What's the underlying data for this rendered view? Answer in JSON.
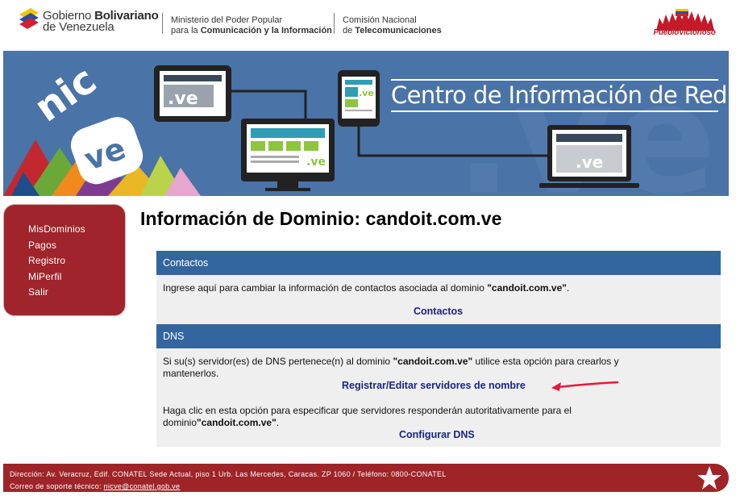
{
  "header": {
    "gov_line1_prefix": "Gobierno ",
    "gov_line1_bold": "Bolivariano",
    "gov_line2": "de Venezuela",
    "ministry_line1": "Ministerio del Poder Popular",
    "ministry_line2_prefix": "para la ",
    "ministry_line2_bold": "Comunicación y la Información",
    "comision_line1": "Comisión Nacional",
    "comision_line2_prefix": "de ",
    "comision_line2_bold": "Telecomunicaciones",
    "right_logo_text": "PuebloVictorioso"
  },
  "banner": {
    "title": "Centro de Información de Red",
    "logo_text_top": "nic",
    "logo_text_bottom": "ve",
    "screen_label": ".ve"
  },
  "sidebar": {
    "items": [
      {
        "label": "MisDominios"
      },
      {
        "label": "Pagos"
      },
      {
        "label": "Registro"
      },
      {
        "label": "MiPerfil"
      },
      {
        "label": "Salir"
      }
    ]
  },
  "main": {
    "title": "Información de Dominio: candoit.com.ve",
    "contactos": {
      "header": "Contactos",
      "text_prefix": "Ingrese aquí para cambiar la información de contactos asociada al dominio ",
      "domain": "\"candoit.com.ve\"",
      "text_suffix": ".",
      "link": "Contactos"
    },
    "dns": {
      "header": "DNS",
      "text1_prefix": "Si su(s) servidor(es) de DNS pertenece(n) al dominio ",
      "domain": "\"candoit.com.ve\"",
      "text1_suffix": " utilice esta opción para crearlos y mantenerlos.",
      "link1": "Registrar/Editar servidores de nombre",
      "text2_prefix": "Haga clic en esta opción para especificar que servidores responderán autoritativamente para el dominio",
      "text2_suffix": ".",
      "link2": "Configurar DNS"
    }
  },
  "footer": {
    "address": "Dirección: Av. Veracruz, Edif. CONATEL Sede Actual, piso 1 Urb. Las Mercedes, Caracas. ZP 1060 / Teléfono: 0800-CONATEL",
    "support_label": "Correo de soporte técnico: ",
    "support_email": "nicve@conatel.gob.ve"
  },
  "colors": {
    "accent_blue": "#33659f",
    "banner_blue": "#4a73a7",
    "accent_red": "#a0242b",
    "link_navy": "#172583",
    "arrow_red": "#e8183a"
  }
}
